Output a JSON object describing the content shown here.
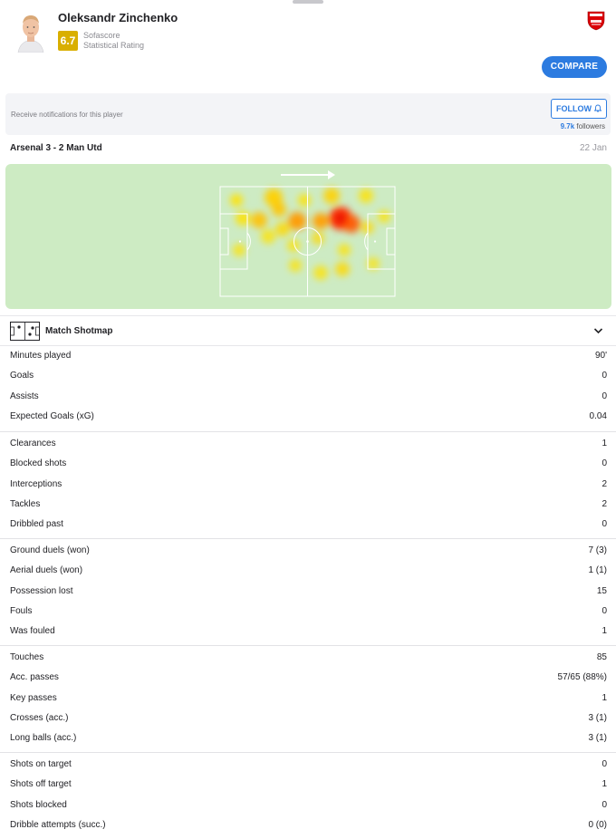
{
  "player": {
    "name": "Oleksandr Zinchenko",
    "rating": "6.7",
    "rating_source_line1": "Sofascore",
    "rating_source_line2": "Statistical Rating",
    "rating_color": "#d9af00",
    "avatar_icon": "player-avatar-icon",
    "club_icon": "arsenal-crest-icon"
  },
  "actions": {
    "compare_label": "COMPARE",
    "accent_color": "#2c7be0"
  },
  "follow": {
    "text": "Receive notifications for this player",
    "button_label": "FOLLOW",
    "followers_count": "9.7k",
    "followers_label": "followers"
  },
  "match": {
    "title": "Arsenal 3 - 2 Man Utd",
    "date": "22 Jan"
  },
  "heatmap": {
    "background_color": "#cdebc3",
    "direction_icon": "attack-direction-arrow-icon"
  },
  "shotmap": {
    "label": "Match Shotmap",
    "icon": "pitch-icon",
    "toggle_icon": "chevron-down-icon"
  },
  "stat_groups": [
    [
      {
        "label": "Minutes played",
        "value": "90'"
      },
      {
        "label": "Goals",
        "value": "0"
      },
      {
        "label": "Assists",
        "value": "0"
      },
      {
        "label": "Expected Goals (xG)",
        "value": "0.04"
      }
    ],
    [
      {
        "label": "Clearances",
        "value": "1"
      },
      {
        "label": "Blocked shots",
        "value": "0"
      },
      {
        "label": "Interceptions",
        "value": "2"
      },
      {
        "label": "Tackles",
        "value": "2"
      },
      {
        "label": "Dribbled past",
        "value": "0"
      }
    ],
    [
      {
        "label": "Ground duels (won)",
        "value": "7 (3)"
      },
      {
        "label": "Aerial duels (won)",
        "value": "1 (1)"
      },
      {
        "label": "Possession lost",
        "value": "15"
      },
      {
        "label": "Fouls",
        "value": "0"
      },
      {
        "label": "Was fouled",
        "value": "1"
      }
    ],
    [
      {
        "label": "Touches",
        "value": "85"
      },
      {
        "label": "Acc. passes",
        "value": "57/65 (88%)"
      },
      {
        "label": "Key passes",
        "value": "1"
      },
      {
        "label": "Crosses (acc.)",
        "value": "3 (1)"
      },
      {
        "label": "Long balls (acc.)",
        "value": "3 (1)"
      }
    ],
    [
      {
        "label": "Shots on target",
        "value": "0"
      },
      {
        "label": "Shots off target",
        "value": "1"
      },
      {
        "label": "Shots blocked",
        "value": "0"
      },
      {
        "label": "Dribble attempts (succ.)",
        "value": "0 (0)"
      }
    ]
  ]
}
